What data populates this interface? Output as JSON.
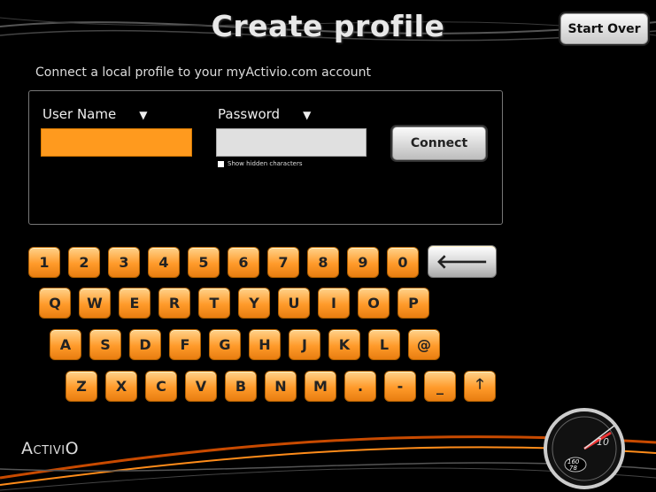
{
  "header": {
    "title": "Create profile",
    "start_over_label": "Start Over"
  },
  "subtitle": "Connect a local profile to your myActivio.com account",
  "form": {
    "user_label": "User Name",
    "user_value": "",
    "password_label": "Password",
    "password_value": "",
    "show_hidden_label": "Show hidden characters",
    "connect_label": "Connect",
    "dropdown_glyph": "▼"
  },
  "keyboard": {
    "row1": [
      "1",
      "2",
      "3",
      "4",
      "5",
      "6",
      "7",
      "8",
      "9",
      "0"
    ],
    "backspace_glyph": "🡐",
    "row2": [
      "Q",
      "W",
      "E",
      "R",
      "T",
      "Y",
      "U",
      "I",
      "O",
      "P"
    ],
    "row3": [
      "A",
      "S",
      "D",
      "F",
      "G",
      "H",
      "J",
      "K",
      "L",
      "@"
    ],
    "row4": [
      "Z",
      "X",
      "C",
      "V",
      "B",
      "N",
      "M",
      ".",
      "-",
      "_"
    ],
    "shift_glyph": "🡑"
  },
  "brand": {
    "logo_text": "ActiviO",
    "gauge_value": "10",
    "gauge_top": "160",
    "gauge_bottom": "78"
  },
  "colors": {
    "accent": "#ff9a1e",
    "background": "#000000",
    "field_active": "#ff9a1e"
  }
}
